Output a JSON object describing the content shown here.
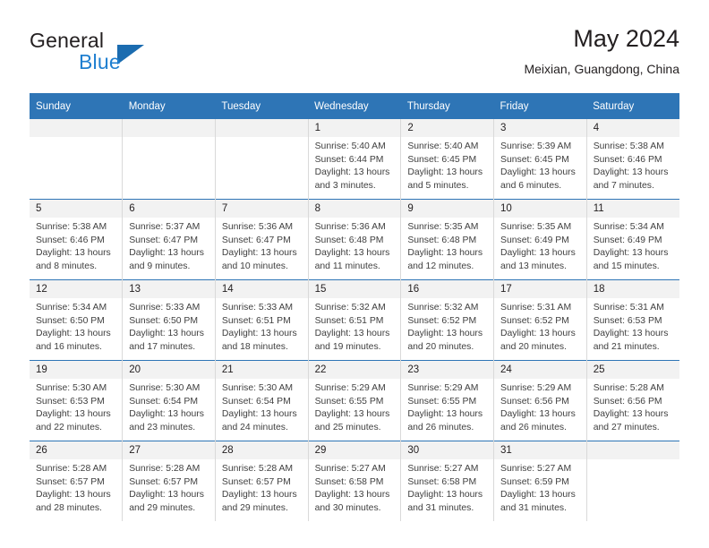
{
  "brand": {
    "name_top": "General",
    "name_bottom": "Blue",
    "triangle_icon": "triangle-logo-icon",
    "accent_color": "#1b6cb0"
  },
  "header": {
    "title": "May 2024",
    "subtitle": "Meixian, Guangdong, China"
  },
  "colors": {
    "header_row_bg": "#2e75b6",
    "daynum_bg": "#f2f2f2",
    "grid_line": "#d9d9d9",
    "text": "#404040"
  },
  "weekdays": [
    "Sunday",
    "Monday",
    "Tuesday",
    "Wednesday",
    "Thursday",
    "Friday",
    "Saturday"
  ],
  "weeks": [
    [
      {
        "day": "",
        "empty": true
      },
      {
        "day": "",
        "empty": true
      },
      {
        "day": "",
        "empty": true
      },
      {
        "day": "1",
        "sunrise": "Sunrise: 5:40 AM",
        "sunset": "Sunset: 6:44 PM",
        "daylight1": "Daylight: 13 hours",
        "daylight2": "and 3 minutes."
      },
      {
        "day": "2",
        "sunrise": "Sunrise: 5:40 AM",
        "sunset": "Sunset: 6:45 PM",
        "daylight1": "Daylight: 13 hours",
        "daylight2": "and 5 minutes."
      },
      {
        "day": "3",
        "sunrise": "Sunrise: 5:39 AM",
        "sunset": "Sunset: 6:45 PM",
        "daylight1": "Daylight: 13 hours",
        "daylight2": "and 6 minutes."
      },
      {
        "day": "4",
        "sunrise": "Sunrise: 5:38 AM",
        "sunset": "Sunset: 6:46 PM",
        "daylight1": "Daylight: 13 hours",
        "daylight2": "and 7 minutes."
      }
    ],
    [
      {
        "day": "5",
        "sunrise": "Sunrise: 5:38 AM",
        "sunset": "Sunset: 6:46 PM",
        "daylight1": "Daylight: 13 hours",
        "daylight2": "and 8 minutes."
      },
      {
        "day": "6",
        "sunrise": "Sunrise: 5:37 AM",
        "sunset": "Sunset: 6:47 PM",
        "daylight1": "Daylight: 13 hours",
        "daylight2": "and 9 minutes."
      },
      {
        "day": "7",
        "sunrise": "Sunrise: 5:36 AM",
        "sunset": "Sunset: 6:47 PM",
        "daylight1": "Daylight: 13 hours",
        "daylight2": "and 10 minutes."
      },
      {
        "day": "8",
        "sunrise": "Sunrise: 5:36 AM",
        "sunset": "Sunset: 6:48 PM",
        "daylight1": "Daylight: 13 hours",
        "daylight2": "and 11 minutes."
      },
      {
        "day": "9",
        "sunrise": "Sunrise: 5:35 AM",
        "sunset": "Sunset: 6:48 PM",
        "daylight1": "Daylight: 13 hours",
        "daylight2": "and 12 minutes."
      },
      {
        "day": "10",
        "sunrise": "Sunrise: 5:35 AM",
        "sunset": "Sunset: 6:49 PM",
        "daylight1": "Daylight: 13 hours",
        "daylight2": "and 13 minutes."
      },
      {
        "day": "11",
        "sunrise": "Sunrise: 5:34 AM",
        "sunset": "Sunset: 6:49 PM",
        "daylight1": "Daylight: 13 hours",
        "daylight2": "and 15 minutes."
      }
    ],
    [
      {
        "day": "12",
        "sunrise": "Sunrise: 5:34 AM",
        "sunset": "Sunset: 6:50 PM",
        "daylight1": "Daylight: 13 hours",
        "daylight2": "and 16 minutes."
      },
      {
        "day": "13",
        "sunrise": "Sunrise: 5:33 AM",
        "sunset": "Sunset: 6:50 PM",
        "daylight1": "Daylight: 13 hours",
        "daylight2": "and 17 minutes."
      },
      {
        "day": "14",
        "sunrise": "Sunrise: 5:33 AM",
        "sunset": "Sunset: 6:51 PM",
        "daylight1": "Daylight: 13 hours",
        "daylight2": "and 18 minutes."
      },
      {
        "day": "15",
        "sunrise": "Sunrise: 5:32 AM",
        "sunset": "Sunset: 6:51 PM",
        "daylight1": "Daylight: 13 hours",
        "daylight2": "and 19 minutes."
      },
      {
        "day": "16",
        "sunrise": "Sunrise: 5:32 AM",
        "sunset": "Sunset: 6:52 PM",
        "daylight1": "Daylight: 13 hours",
        "daylight2": "and 20 minutes."
      },
      {
        "day": "17",
        "sunrise": "Sunrise: 5:31 AM",
        "sunset": "Sunset: 6:52 PM",
        "daylight1": "Daylight: 13 hours",
        "daylight2": "and 20 minutes."
      },
      {
        "day": "18",
        "sunrise": "Sunrise: 5:31 AM",
        "sunset": "Sunset: 6:53 PM",
        "daylight1": "Daylight: 13 hours",
        "daylight2": "and 21 minutes."
      }
    ],
    [
      {
        "day": "19",
        "sunrise": "Sunrise: 5:30 AM",
        "sunset": "Sunset: 6:53 PM",
        "daylight1": "Daylight: 13 hours",
        "daylight2": "and 22 minutes."
      },
      {
        "day": "20",
        "sunrise": "Sunrise: 5:30 AM",
        "sunset": "Sunset: 6:54 PM",
        "daylight1": "Daylight: 13 hours",
        "daylight2": "and 23 minutes."
      },
      {
        "day": "21",
        "sunrise": "Sunrise: 5:30 AM",
        "sunset": "Sunset: 6:54 PM",
        "daylight1": "Daylight: 13 hours",
        "daylight2": "and 24 minutes."
      },
      {
        "day": "22",
        "sunrise": "Sunrise: 5:29 AM",
        "sunset": "Sunset: 6:55 PM",
        "daylight1": "Daylight: 13 hours",
        "daylight2": "and 25 minutes."
      },
      {
        "day": "23",
        "sunrise": "Sunrise: 5:29 AM",
        "sunset": "Sunset: 6:55 PM",
        "daylight1": "Daylight: 13 hours",
        "daylight2": "and 26 minutes."
      },
      {
        "day": "24",
        "sunrise": "Sunrise: 5:29 AM",
        "sunset": "Sunset: 6:56 PM",
        "daylight1": "Daylight: 13 hours",
        "daylight2": "and 26 minutes."
      },
      {
        "day": "25",
        "sunrise": "Sunrise: 5:28 AM",
        "sunset": "Sunset: 6:56 PM",
        "daylight1": "Daylight: 13 hours",
        "daylight2": "and 27 minutes."
      }
    ],
    [
      {
        "day": "26",
        "sunrise": "Sunrise: 5:28 AM",
        "sunset": "Sunset: 6:57 PM",
        "daylight1": "Daylight: 13 hours",
        "daylight2": "and 28 minutes."
      },
      {
        "day": "27",
        "sunrise": "Sunrise: 5:28 AM",
        "sunset": "Sunset: 6:57 PM",
        "daylight1": "Daylight: 13 hours",
        "daylight2": "and 29 minutes."
      },
      {
        "day": "28",
        "sunrise": "Sunrise: 5:28 AM",
        "sunset": "Sunset: 6:57 PM",
        "daylight1": "Daylight: 13 hours",
        "daylight2": "and 29 minutes."
      },
      {
        "day": "29",
        "sunrise": "Sunrise: 5:27 AM",
        "sunset": "Sunset: 6:58 PM",
        "daylight1": "Daylight: 13 hours",
        "daylight2": "and 30 minutes."
      },
      {
        "day": "30",
        "sunrise": "Sunrise: 5:27 AM",
        "sunset": "Sunset: 6:58 PM",
        "daylight1": "Daylight: 13 hours",
        "daylight2": "and 31 minutes."
      },
      {
        "day": "31",
        "sunrise": "Sunrise: 5:27 AM",
        "sunset": "Sunset: 6:59 PM",
        "daylight1": "Daylight: 13 hours",
        "daylight2": "and 31 minutes."
      },
      {
        "day": "",
        "empty": true
      }
    ]
  ]
}
